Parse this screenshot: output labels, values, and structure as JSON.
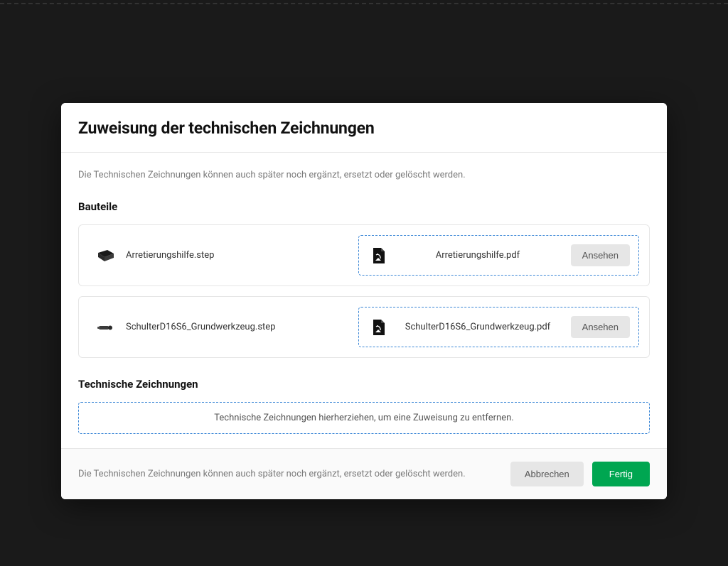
{
  "modal": {
    "title": "Zuweisung der technischen Zeichnungen",
    "body_note": "Die Technischen Zeichnungen können auch später noch ergänzt, ersetzt oder gelöscht werden.",
    "parts_title": "Bauteile",
    "parts": [
      {
        "step_name": "Arretierungshilfe.step",
        "pdf_name": "Arretierungshilfe.pdf",
        "view_label": "Ansehen"
      },
      {
        "step_name": "SchulterD16S6_Grundwerkzeug.step",
        "pdf_name": "SchulterD16S6_Grundwerkzeug.pdf",
        "view_label": "Ansehen"
      }
    ],
    "drawings_title": "Technische Zeichnungen",
    "remove_zone_text": "Technische Zeichnungen hierherziehen, um eine Zuweisung zu entfernen.",
    "footer_note": "Die Technischen Zeichnungen können auch später noch ergänzt, ersetzt oder gelöscht werden.",
    "cancel_label": "Abbrechen",
    "done_label": "Fertig"
  }
}
